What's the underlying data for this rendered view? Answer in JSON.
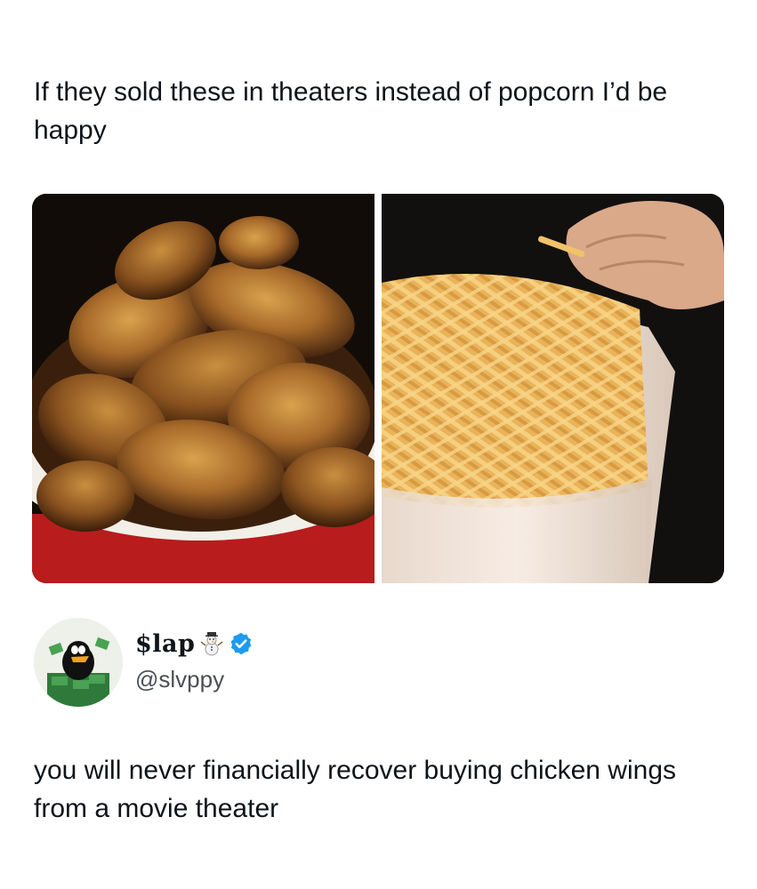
{
  "original_tweet": {
    "text": "If they sold these in theaters instead of popcorn I’d be happy"
  },
  "media": {
    "left_image": "chicken-wings-bucket",
    "right_image": "french-fries-tub"
  },
  "reply_author": {
    "display_name": "$lap",
    "emoji_icon": "snowman-icon",
    "verified_icon": "verified-badge-icon",
    "verified_color": "#1d9bf0",
    "handle": "@slvppy",
    "avatar_icon": "cartoon-duck-money-avatar"
  },
  "reply_tweet": {
    "text": "you will never financially recover buying chicken wings from a movie theater"
  }
}
